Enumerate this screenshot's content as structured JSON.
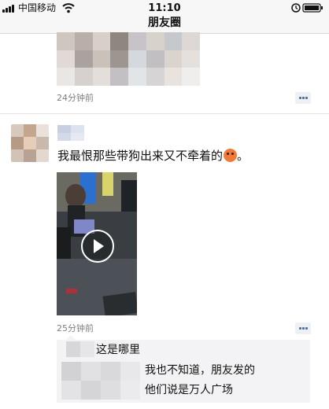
{
  "status_bar": {
    "carrier": "中国移动",
    "time": "11:10",
    "battery_icon": "battery-icon",
    "wifi_icon": "wifi-icon",
    "signal_icon": "signal-icon"
  },
  "navbar": {
    "title": "朋友圈"
  },
  "posts": [
    {
      "timestamp": "24分钟前",
      "action_icon": "comment-dots-icon"
    },
    {
      "text": "我最恨那些带狗出来又不牵着的",
      "text_suffix": "。",
      "emoji_icon": "angry-face-emoji-icon",
      "media": "video",
      "play_icon": "play-icon",
      "timestamp": "25分钟前",
      "action_icon": "comment-dots-icon",
      "comments": [
        {
          "text": "这是哪里"
        },
        {
          "text": "我也不知道，朋友发的"
        },
        {
          "text": "他们说是万人广场"
        }
      ]
    }
  ],
  "colors": {
    "bar_bg": "#f7f7f7",
    "timestamp": "#7f7f7f",
    "link_blue": "#576b95",
    "comment_bg": "#f3f3f5"
  }
}
